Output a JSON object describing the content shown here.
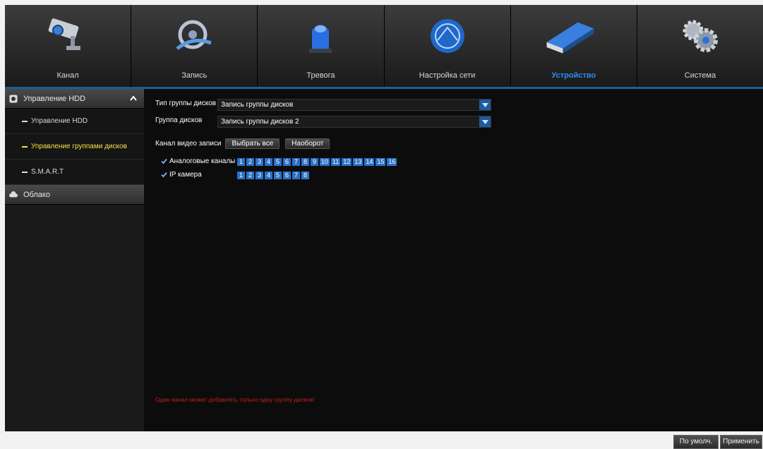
{
  "tabs": [
    {
      "label": "Канал",
      "icon": "camera-icon",
      "active": false
    },
    {
      "label": "Запись",
      "icon": "film-reel-icon",
      "active": false
    },
    {
      "label": "Тревога",
      "icon": "alarm-light-icon",
      "active": false
    },
    {
      "label": "Настройка сети",
      "icon": "network-globe-icon",
      "active": false
    },
    {
      "label": "Устройство",
      "icon": "hard-drive-icon",
      "active": true
    },
    {
      "label": "Система",
      "icon": "gears-icon",
      "active": false
    }
  ],
  "sidebar": {
    "hdd_header": "Управление HDD",
    "items": [
      {
        "label": "Управление HDD",
        "active": false
      },
      {
        "label": "Управление группами дисков",
        "active": true
      },
      {
        "label": "S.M.A.R.T",
        "active": false
      }
    ],
    "cloud_header": "Облако"
  },
  "form": {
    "group_type_label": "Тип группы дисков",
    "group_type_value": "Запись группы дисков",
    "disk_group_label": "Группа дисков",
    "disk_group_value": "Запись группы дисков 2",
    "record_channel_label": "Канал видео записи",
    "select_all": "Выбрать все",
    "invert": "Наоборот",
    "analog_label": "Аналоговые каналы",
    "analog_channels": [
      "1",
      "2",
      "3",
      "4",
      "5",
      "6",
      "7",
      "8",
      "9",
      "10",
      "11",
      "12",
      "13",
      "14",
      "15",
      "16"
    ],
    "ip_label": "IP камера",
    "ip_channels": [
      "1",
      "2",
      "3",
      "4",
      "5",
      "6",
      "7",
      "8"
    ]
  },
  "warning": "Один канал может добавлять только одну группу дисков!",
  "footer": {
    "default_label": "По умолч.",
    "apply_label": "Применить"
  },
  "colors": {
    "accent": "#2b8ff0",
    "channel": "#2a72c8",
    "active_side": "#f5e04a",
    "warning": "#c41f1f"
  }
}
